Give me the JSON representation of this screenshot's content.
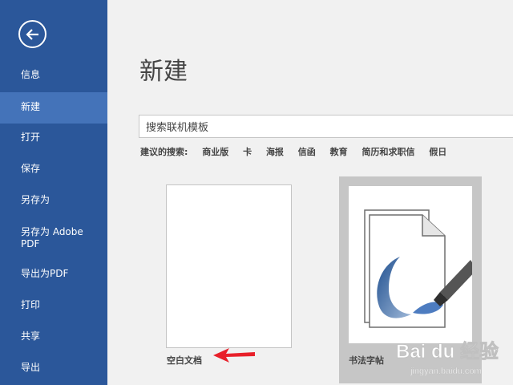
{
  "sidebar": {
    "items": [
      {
        "label": "信息",
        "active": false
      },
      {
        "label": "新建",
        "active": true
      },
      {
        "label": "打开",
        "active": false
      },
      {
        "label": "保存",
        "active": false
      },
      {
        "label": "另存为",
        "active": false
      },
      {
        "label": "另存为 Adobe\nPDF",
        "active": false
      },
      {
        "label": "导出为PDF",
        "active": false
      },
      {
        "label": "打印",
        "active": false
      },
      {
        "label": "共享",
        "active": false
      },
      {
        "label": "导出",
        "active": false
      }
    ]
  },
  "main": {
    "title": "新建",
    "search": {
      "value": "搜索联机模板"
    },
    "suggested": {
      "label": "建议的搜索:",
      "links": [
        "商业版",
        "卡",
        "海报",
        "信函",
        "教育",
        "简历和求职信",
        "假日"
      ]
    },
    "templates": [
      {
        "label": "空白文档"
      },
      {
        "label": "书法字帖"
      }
    ]
  },
  "watermark": {
    "logo_text": "Bai du 经验",
    "url": "jingyan.baidu.com"
  },
  "colors": {
    "sidebar_bg": "#2b579a",
    "sidebar_active": "#4473b9",
    "annotation_arrow": "#e8202a"
  },
  "icons": {
    "back": "back-arrow-icon",
    "annotation": "red-arrow-icon"
  }
}
